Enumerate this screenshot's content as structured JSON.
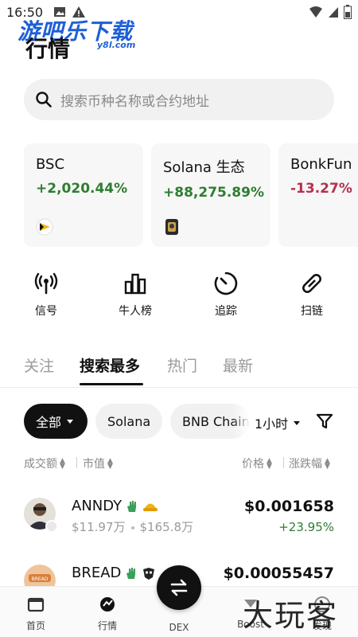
{
  "status_bar": {
    "time": "16:50"
  },
  "watermark": {
    "main": "游吧乐下载",
    "sub": "y8l.com",
    "bottom": "大玩客"
  },
  "header": {
    "title": "行情"
  },
  "search": {
    "placeholder": "搜索币种名称或合约地址"
  },
  "cards": [
    {
      "title": "BSC",
      "change": "+2,020.44%",
      "direction": "up"
    },
    {
      "title": "Solana 生态",
      "change": "+88,275.89%",
      "direction": "up"
    },
    {
      "title": "BonkFun",
      "change": "-13.27%",
      "direction": "down"
    }
  ],
  "quick_actions": [
    {
      "label": "信号",
      "icon": "signal-icon"
    },
    {
      "label": "牛人榜",
      "icon": "leaderboard-icon"
    },
    {
      "label": "追踪",
      "icon": "timer-icon"
    },
    {
      "label": "扫链",
      "icon": "scan-chain-icon"
    }
  ],
  "tabs": [
    {
      "label": "关注",
      "active": false
    },
    {
      "label": "搜索最多",
      "active": true
    },
    {
      "label": "热门",
      "active": false
    },
    {
      "label": "最新",
      "active": false
    }
  ],
  "chips": [
    {
      "label": "全部",
      "active": true
    },
    {
      "label": "Solana",
      "active": false
    },
    {
      "label": "BNB Chain",
      "active": false
    }
  ],
  "timeframe": "1小时",
  "columns": {
    "volume": "成交额",
    "market_cap": "市值",
    "price": "价格",
    "change": "涨跌幅"
  },
  "tokens": [
    {
      "name": "ANNDY",
      "volume": "$11.97万",
      "market_cap": "$165.8万",
      "price": "$0.001658",
      "change": "+23.95%"
    },
    {
      "name": "BREAD",
      "price": "$0.00055457"
    }
  ],
  "bottom_nav": [
    {
      "label": "首页",
      "icon": "wallet-icon"
    },
    {
      "label": "行情",
      "icon": "market-icon"
    },
    {
      "label": "DEX",
      "icon": "swap-icon"
    },
    {
      "label": "Boost",
      "icon": "boost-icon"
    },
    {
      "label": "发现",
      "icon": "discover-icon"
    }
  ],
  "colors": {
    "up": "#2e7d32",
    "down": "#b4314e",
    "accent": "#111111"
  }
}
